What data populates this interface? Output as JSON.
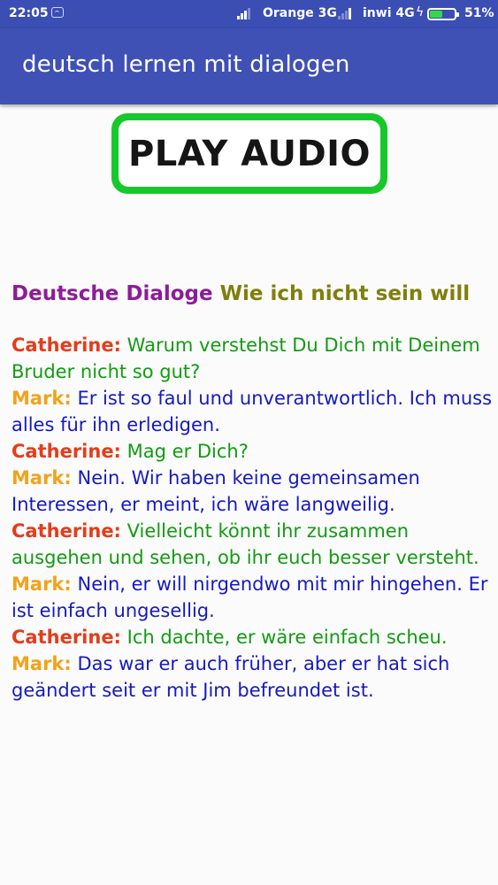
{
  "status_bar": {
    "time": "22:05",
    "carrier_1": "Orange 3G",
    "carrier_2": "inwi 4G",
    "battery_percent": "51%",
    "battery_level": 0.51
  },
  "app_bar": {
    "title": "deutsch lernen mit dialogen"
  },
  "play_button": {
    "label": "PLAY AUDIO"
  },
  "dialog": {
    "heading_prefix": "Deutsche Dialoge",
    "heading_title": "Wie ich nicht sein will",
    "lines": [
      {
        "speaker": "Catherine:",
        "text": "Warum verstehst Du Dich mit Deinem Bruder nicht so gut?",
        "speaker_color": "#e53c1a",
        "text_color": "#129b12"
      },
      {
        "speaker": "Mark:",
        "text": "Er ist so faul und unverantwortlich. Ich muss alles für ihn erledigen.",
        "speaker_color": "#f0a31b",
        "text_color": "#1719c0"
      },
      {
        "speaker": "Catherine:",
        "text": "Mag er Dich?",
        "speaker_color": "#e53c1a",
        "text_color": "#129b12"
      },
      {
        "speaker": "Mark:",
        "text": "Nein. Wir haben keine gemeinsamen Interessen, er meint, ich wäre langweilig.",
        "speaker_color": "#f0a31b",
        "text_color": "#1719c0"
      },
      {
        "speaker": "Catherine:",
        "text": "Vielleicht könnt ihr zusammen ausgehen und sehen, ob ihr euch besser versteht.",
        "speaker_color": "#e53c1a",
        "text_color": "#129b12"
      },
      {
        "speaker": "Mark:",
        "text": "Nein, er will nirgendwo mit mir hingehen. Er ist einfach ungesellig.",
        "speaker_color": "#f0a31b",
        "text_color": "#1719c0"
      },
      {
        "speaker": "Catherine:",
        "text": "Ich dachte, er wäre einfach scheu.",
        "speaker_color": "#e53c1a",
        "text_color": "#129b12"
      },
      {
        "speaker": "Mark:",
        "text": "Das war er auch früher, aber er hat sich geändert seit er mit Jim befreundet ist.",
        "speaker_color": "#f0a31b",
        "text_color": "#1719c0"
      }
    ]
  }
}
